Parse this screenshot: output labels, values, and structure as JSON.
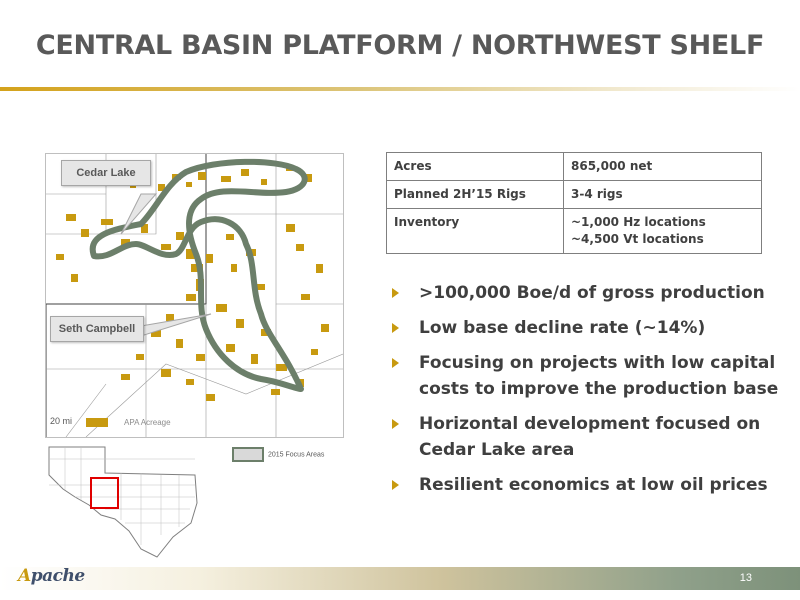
{
  "slide": {
    "title": "CENTRAL BASIN PLATFORM / NORTHWEST SHELF",
    "page_number": "13"
  },
  "map": {
    "callouts": [
      "Cedar Lake",
      "Seth Campbell"
    ],
    "scale_label": "20 mi",
    "legend_acreage": "APA Acreage",
    "legend_focus": "2015 Focus Areas",
    "colors": {
      "acreage": "#c89a10",
      "focus_outline": "#6c7f6a",
      "inset_highlight": "#e00000"
    }
  },
  "stats_table": {
    "rows": [
      {
        "label": "Acres",
        "value": "865,000 net"
      },
      {
        "label": "Planned 2H’15 Rigs",
        "value": "3-4 rigs"
      },
      {
        "label": "Inventory",
        "value": "~1,000 Hz locations",
        "value2": "~4,500 Vt locations"
      }
    ]
  },
  "bullets": [
    ">100,000 Boe/d of gross production",
    "Low base decline rate (~14%)",
    "Focusing on projects with low capital costs to improve the production base",
    "Horizontal development focused on Cedar Lake area",
    "Resilient economics at low oil prices"
  ],
  "footer": {
    "logo_mark": "A",
    "logo_rest": "pache"
  }
}
